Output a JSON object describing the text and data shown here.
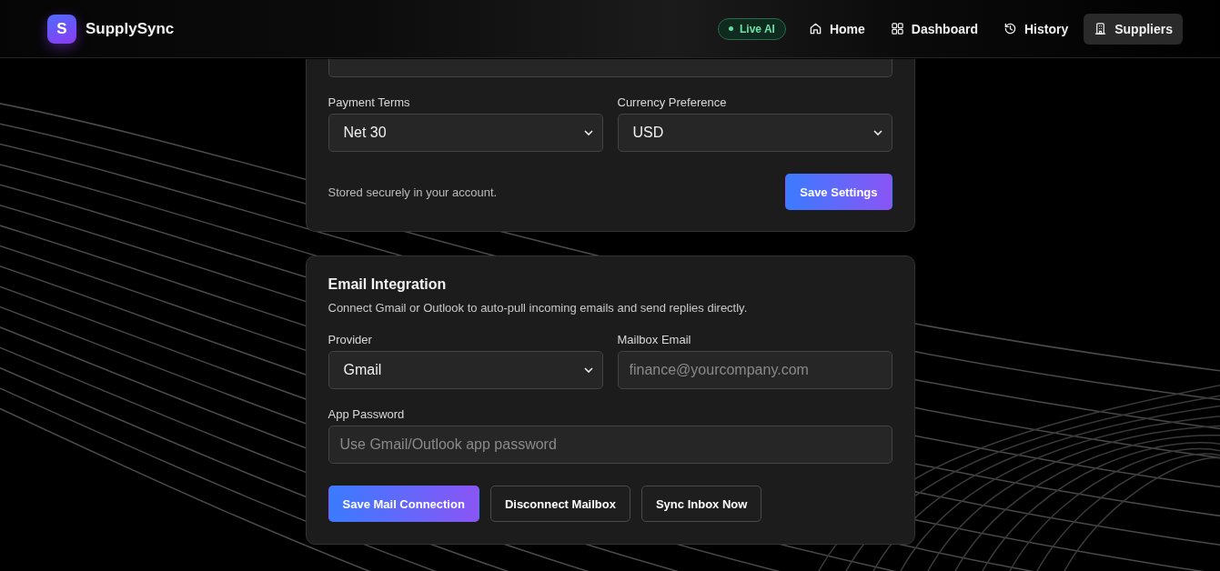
{
  "header": {
    "logo_letter": "S",
    "brand": "SupplySync",
    "status_badge": "Live AI",
    "nav": [
      {
        "label": "Home",
        "kind": "home",
        "selected": false
      },
      {
        "label": "Dashboard",
        "kind": "grid",
        "selected": false
      },
      {
        "label": "History",
        "kind": "history",
        "selected": false
      },
      {
        "label": "Suppliers",
        "kind": "building",
        "selected": true
      }
    ]
  },
  "settings_card": {
    "payment_terms": {
      "label": "Payment Terms",
      "value": "Net 30"
    },
    "currency": {
      "label": "Currency Preference",
      "value": "USD"
    },
    "note": "Stored securely in your account.",
    "save_button": "Save Settings"
  },
  "email_card": {
    "title": "Email Integration",
    "description": "Connect Gmail or Outlook to auto-pull incoming emails and send replies directly.",
    "provider": {
      "label": "Provider",
      "value": "Gmail"
    },
    "mailbox": {
      "label": "Mailbox Email",
      "placeholder": "finance@yourcompany.com"
    },
    "app_password": {
      "label": "App Password",
      "placeholder": "Use Gmail/Outlook app password"
    },
    "buttons": [
      {
        "label": "Save Mail Connection",
        "kind": "primary"
      },
      {
        "label": "Disconnect Mailbox",
        "kind": "secondary"
      },
      {
        "label": "Sync Inbox Now",
        "kind": "secondary"
      }
    ]
  }
}
